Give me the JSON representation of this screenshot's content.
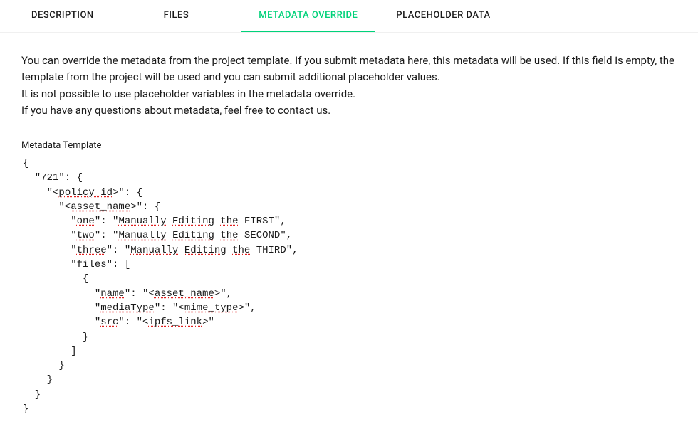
{
  "tabs": {
    "description": "DESCRIPTION",
    "files": "FILES",
    "metadataOverride": "METADATA OVERRIDE",
    "placeholderData": "PLACEHOLDER DATA",
    "active": "metadataOverride"
  },
  "body": {
    "p1": "You can override the metadata from the project template. If you submit metadata here, this metadata will be used. If this field is empty, the template from the project will be used and you can submit additional placeholder values.",
    "p2": "It is not possible to use placeholder variables in the metadata override.",
    "p3": "If you have any questions about metadata, feel free to contact us."
  },
  "fieldLabel": "Metadata Template",
  "code": {
    "l1": "{",
    "l2_a": "  \"721\": {",
    "l3_a": "    \"<",
    "l3_sp": "policy_id",
    "l3_b": ">\": {",
    "l4_a": "      \"<",
    "l4_sp": "asset_name",
    "l4_b": ">\": {",
    "l5_a": "        \"",
    "l5_sp1": "one",
    "l5_b": "\": \"",
    "l5_sp2": "Manually",
    "l5_c": " ",
    "l5_sp3": "Editing",
    "l5_d": " ",
    "l5_sp4": "the",
    "l5_e": " FIRST\",",
    "l6_a": "        \"",
    "l6_sp1": "two",
    "l6_b": "\": \"",
    "l6_sp2": "Manually",
    "l6_c": " ",
    "l6_sp3": "Editing",
    "l6_d": " ",
    "l6_sp4": "the",
    "l6_e": " SECOND\",",
    "l7_a": "        \"",
    "l7_sp1": "three",
    "l7_b": "\": \"",
    "l7_sp2": "Manually",
    "l7_c": " ",
    "l7_sp3": "Editing",
    "l7_d": " ",
    "l7_sp4": "the",
    "l7_e": " THIRD\",",
    "l8": "        \"files\": [",
    "l9": "          {",
    "l10_a": "            \"",
    "l10_sp1": "name",
    "l10_b": "\": \"<",
    "l10_sp2": "asset_name",
    "l10_c": ">\",",
    "l11_a": "            \"",
    "l11_sp1": "mediaType",
    "l11_b": "\": \"<",
    "l11_sp2": "mime_type",
    "l11_c": ">\",",
    "l12_a": "            \"",
    "l12_sp1": "src",
    "l12_b": "\": \"<",
    "l12_sp2": "ipfs_link",
    "l12_c": ">\"",
    "l13": "          }",
    "l14": "        ]",
    "l15": "      }",
    "l16": "    }",
    "l17": "  }",
    "l18": "}"
  }
}
